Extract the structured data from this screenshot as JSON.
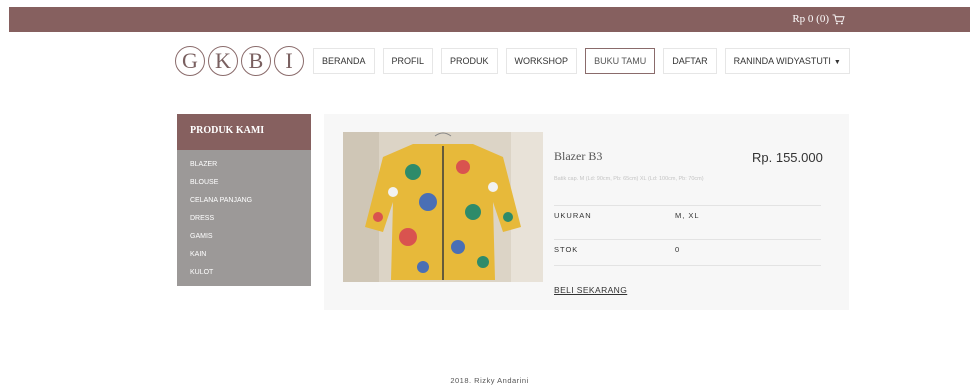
{
  "topbar": {
    "cart_label": "Rp 0 (0)",
    "cart_icon": "cart-icon"
  },
  "logo": {
    "letters": [
      "G",
      "K",
      "B",
      "I"
    ]
  },
  "nav": {
    "items": [
      "BERANDA",
      "PROFIL",
      "PRODUK",
      "WORKSHOP",
      "BUKU TAMU",
      "DAFTAR"
    ],
    "active": "BUKU TAMU",
    "user_menu": "RANINDA WIDYASTUTI"
  },
  "sidebar": {
    "title": "PRODUK KAMI",
    "items": [
      "BLAZER",
      "BLOUSE",
      "CELANA PANJANG",
      "DRESS",
      "GAMIS",
      "KAIN",
      "KULOT"
    ]
  },
  "product": {
    "name": "Blazer B3",
    "price": "Rp. 155.000",
    "description": "Batik cap. M (Ld: 90cm, Pb: 65cm) XL (Ld: 100cm, Pb: 70cm)",
    "size_label": "UKURAN",
    "size_value": "M, XL",
    "stock_label": "STOK",
    "stock_value": "0",
    "buy_label": "BELI SEKARANG"
  },
  "footer": {
    "text": "2018. Rizky Andarini"
  },
  "colors": {
    "brand": "#86605f",
    "sidebar_bg": "#9c9998",
    "panel_bg": "#f7f7f7"
  }
}
